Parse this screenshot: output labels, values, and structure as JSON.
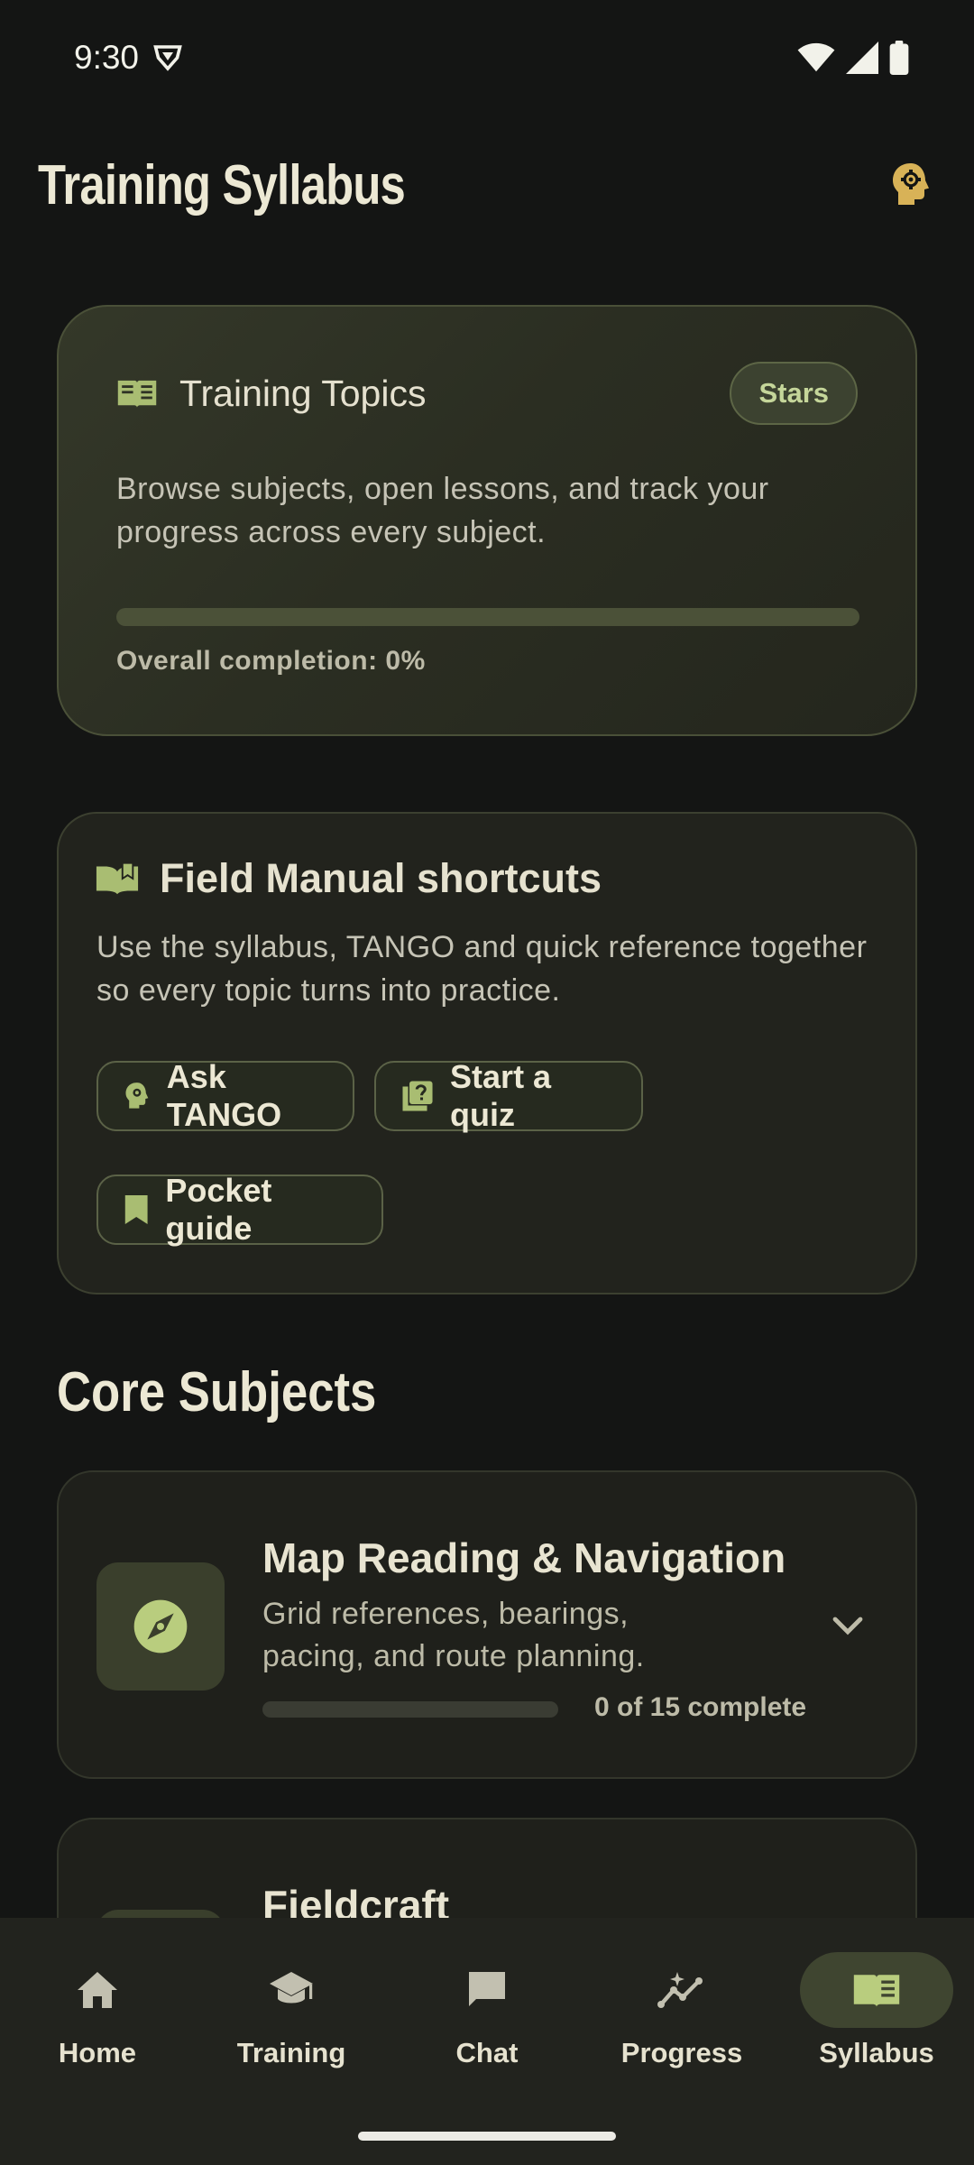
{
  "status_bar": {
    "time": "9:30"
  },
  "header": {
    "title": "Training Syllabus",
    "action_icon": "head-gear-icon"
  },
  "hero": {
    "icon": "open-book-icon",
    "title": "Training Topics",
    "chip_label": "Stars",
    "description": "Browse subjects, open lessons, and track your progress across every subject.",
    "completion_percent": 0,
    "completion_text": "Overall completion: 0%"
  },
  "manual": {
    "icon": "field-manual-icon",
    "title": "Field Manual shortcuts",
    "description": "Use the syllabus, TANGO and quick reference together so every topic turns into practice.",
    "buttons": {
      "ask": "Ask TANGO",
      "quiz": "Start a quiz",
      "guide": "Pocket guide"
    }
  },
  "section": {
    "title": "Core Subjects"
  },
  "subjects": [
    {
      "title": "Map Reading & Navigation",
      "description": "Grid references, bearings, pacing, and route planning.",
      "completed": 0,
      "total": 15,
      "count_text": "0 of 15 complete",
      "icon": "compass-icon"
    },
    {
      "title": "Fieldcraft",
      "icon": "fieldcraft-icon"
    }
  ],
  "nav": {
    "items": [
      "Home",
      "Training",
      "Chat",
      "Progress",
      "Syllabus"
    ],
    "active": "Syllabus"
  },
  "colors": {
    "accent": "#b9cd7e",
    "background": "#141514",
    "card": "#22231d",
    "gold": "#d8b257"
  }
}
